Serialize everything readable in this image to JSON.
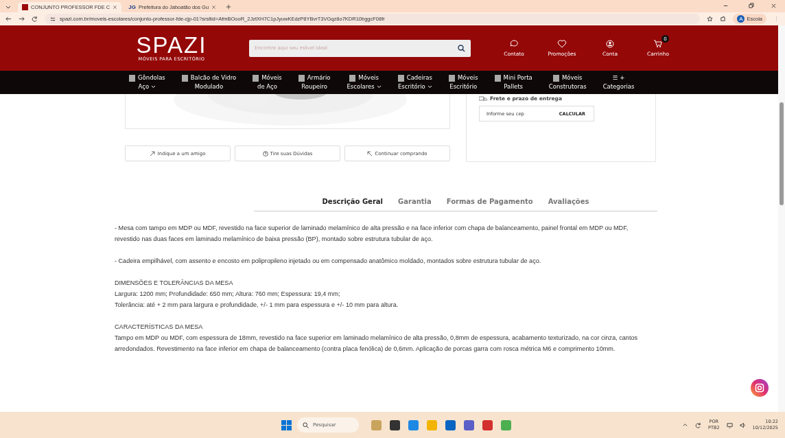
{
  "browser": {
    "tabs": [
      {
        "title": "CONJUNTO PROFESSOR FDE C",
        "selected": true
      },
      {
        "title": "Prefeitura do Jaboatão dos Gu",
        "selected": false,
        "favicon_text": "JG"
      }
    ],
    "url": "spazi.com.br/moveis-escolares/conjunto-professor-fde-cjp-01?srsltid=AfmBOooR_2JztXH7C1pJyuwKEdzP8YBvrT3VGqz8o7KDR10bggcF08fr",
    "profile_initial": "A",
    "profile": "Escola"
  },
  "header": {
    "logo": "SPAZI",
    "tagline": "MÓVEIS PARA ESCRITÓRIO",
    "search_placeholder": "Encontre aqui seu móvel ideal",
    "actions": [
      {
        "kind": "chat",
        "label": "Contato"
      },
      {
        "kind": "heart",
        "label": "Promoções"
      },
      {
        "kind": "user",
        "label": "Conta"
      },
      {
        "kind": "cart",
        "label": "Carrinho",
        "badge": "0"
      }
    ]
  },
  "nav": [
    {
      "line1": "Gôndolas",
      "line2": "Aço",
      "dropdown": true
    },
    {
      "line1": "Balcão de Vidro",
      "line2": "Modulado",
      "dropdown": false
    },
    {
      "line1": "Móveis",
      "line2": "de Aço",
      "dropdown": false
    },
    {
      "line1": "Armário",
      "line2": "Roupeiro",
      "dropdown": false
    },
    {
      "line1": "Móveis",
      "line2": "Escolares",
      "dropdown": true
    },
    {
      "line1": "Cadeiras",
      "line2": "Escritório",
      "dropdown": true
    },
    {
      "line1": "Móveis",
      "line2": "Escritório",
      "dropdown": false
    },
    {
      "line1": "Mini Porta",
      "line2": "Pallets",
      "dropdown": false
    },
    {
      "line1": "Móveis",
      "line2": "Construtoras",
      "dropdown": false
    },
    {
      "line1": "☰ +",
      "line2": "Categorias",
      "dropdown": false
    }
  ],
  "shipping": {
    "title": "Frete e prazo de entrega",
    "placeholder": "Informe seu cep",
    "button": "CALCULAR"
  },
  "product_actions": [
    {
      "kind": "share",
      "label": "Indique a um amigo"
    },
    {
      "kind": "help",
      "label": "Tire suas Dúvidas"
    },
    {
      "kind": "back",
      "label": "Continuar comprando"
    }
  ],
  "tabs": [
    {
      "label": "Descrição Geral",
      "selected": true
    },
    {
      "label": "Garantia",
      "selected": false
    },
    {
      "label": "Formas de Pagamento",
      "selected": false
    },
    {
      "label": "Avaliações",
      "selected": false
    }
  ],
  "description": [
    {
      "lines": [
        "- Mesa com tampo em MDP ou MDF, revestido na face superior de laminado melamínico de alta pressão e na face inferior com chapa de balanceamento, painel frontal em MDP ou MDF, revestido nas duas faces em laminado melamínico de baixa pressão (BP), montado sobre estrutura tubular de aço."
      ]
    },
    {
      "lines": [
        "- Cadeira empilhável, com assento e encosto em polipropileno injetado ou em compensado anatômico moldado, montados sobre estrutura tubular de aço."
      ]
    },
    {
      "heading": "DIMENSÕES E TOLERÂNCIAS DA MESA",
      "lines": [
        "Largura: 1200 mm; Profundidade: 650 mm; Altura: 760 mm; Espessura: 19,4 mm;",
        "Tolerância: até + 2 mm para largura e profundidade, +/- 1 mm para espessura e +/- 10 mm para altura."
      ]
    },
    {
      "heading": "CARACTERÍSTICAS DA MESA",
      "lines": [
        "Tampo em MDP ou MDF, com espessura de 18mm, revestido na face superior em laminado melamínico de alta pressão, 0,8mm de espessura, acabamento texturizado, na cor cinza, cantos arredondados. Revestimento na face inferior em chapa de balanceamento (contra placa fenólica) de 0,6mm. Aplicação de porcas garra com rosca métrica M6 e comprimento 10mm."
      ]
    }
  ],
  "taskbar": {
    "search_placeholder": "Pesquisar",
    "lang": "POR",
    "layout": "PTB2",
    "time": "10:22",
    "date": "10/12/2025"
  }
}
